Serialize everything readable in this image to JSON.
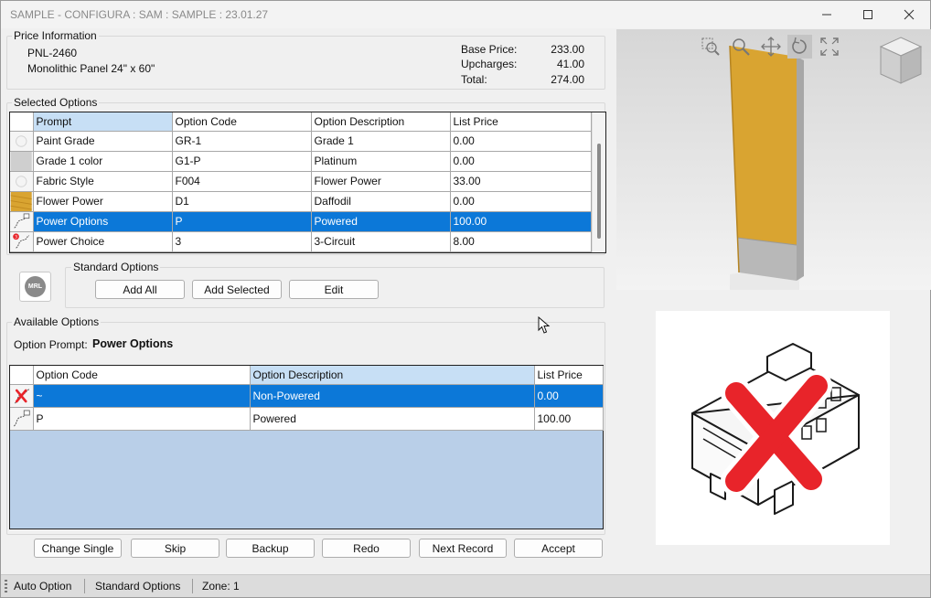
{
  "window": {
    "title": "SAMPLE - CONFIGURA : SAM : SAMPLE : 23.01.27",
    "controls": {
      "minimize": "minimize-icon",
      "maximize": "maximize-icon",
      "close": "close-icon"
    }
  },
  "price_info": {
    "group_label": "Price Information",
    "part_number": "PNL-2460",
    "description": "Monolithic Panel 24\" x 60\"",
    "base_price_label": "Base Price:",
    "base_price": "233.00",
    "upcharges_label": "Upcharges:",
    "upcharges": "41.00",
    "total_label": "Total:",
    "total": "274.00"
  },
  "selected_options": {
    "group_label": "Selected Options",
    "columns": [
      "Prompt",
      "Option Code",
      "Option Description",
      "List Price"
    ],
    "rows": [
      {
        "icon": "paint-swatch-icon",
        "prompt": "Paint Grade",
        "code": "GR-1",
        "description": "Grade 1",
        "price": "0.00"
      },
      {
        "icon": "gray-swatch-icon",
        "prompt": "Grade 1 color",
        "code": "G1-P",
        "description": "Platinum",
        "price": "0.00"
      },
      {
        "icon": "fabric-swatch-icon",
        "prompt": "Fabric Style",
        "code": "F004",
        "description": "Flower Power",
        "price": "33.00"
      },
      {
        "icon": "yellow-fabric-swatch-icon",
        "prompt": "Flower Power",
        "code": "D1",
        "description": "Daffodil",
        "price": "0.00"
      },
      {
        "icon": "power-cord-icon",
        "prompt": "Power Options",
        "code": "P",
        "description": "Powered",
        "price": "100.00"
      },
      {
        "icon": "power-circuit-icon",
        "prompt": "Power Choice",
        "code": "3",
        "description": "3-Circuit",
        "price": "8.00"
      }
    ],
    "selected_index": 4
  },
  "standard_options": {
    "group_label": "Standard Options",
    "logo_text": "MRL",
    "add_all": "Add All",
    "add_selected": "Add Selected",
    "edit": "Edit"
  },
  "available_options": {
    "group_label": "Available Options",
    "prompt_label": "Option Prompt:",
    "prompt_value": "Power Options",
    "columns": [
      "Option Code",
      "Option Description",
      "List Price"
    ],
    "rows": [
      {
        "icon": "no-power-icon",
        "code": "~",
        "description": "Non-Powered",
        "price": "0.00"
      },
      {
        "icon": "power-cord-icon",
        "code": "P",
        "description": "Powered",
        "price": "100.00"
      }
    ],
    "selected_index": 0
  },
  "actions": {
    "change_single": "Change Single",
    "skip": "Skip",
    "backup": "Backup",
    "redo": "Redo",
    "next_record": "Next Record",
    "accept": "Accept"
  },
  "viewer_tools": [
    "zoom-window-icon",
    "zoom-icon",
    "pan-icon",
    "rotate-icon",
    "fit-view-icon",
    "view-cube-icon"
  ],
  "status": {
    "auto_option": "Auto Option",
    "standard_options": "Standard Options",
    "zone": "Zone: 1"
  },
  "colors": {
    "selection": "#0c78d8",
    "panel_fabric": "#d9a431",
    "sorted_header": "#c7dff5",
    "empty_grid": "#b9cfe8",
    "no_power_mark": "#e8242a"
  }
}
